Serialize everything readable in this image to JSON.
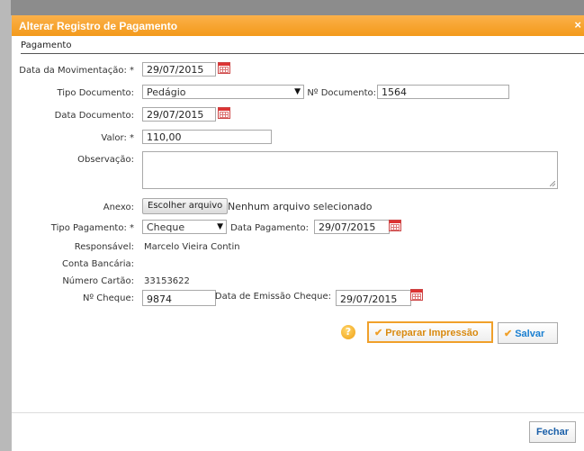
{
  "dialog": {
    "title": "Alterar Registro de Pagamento",
    "close_glyph": "×",
    "section": "Pagamento"
  },
  "form": {
    "data_movimentacao": {
      "label": "Data da Movimentação: *",
      "value": "29/07/2015"
    },
    "tipo_documento": {
      "label": "Tipo Documento:",
      "value": "Pedágio"
    },
    "numero_documento": {
      "label": "Nº Documento:",
      "value": "1564"
    },
    "data_documento": {
      "label": "Data Documento:",
      "value": "29/07/2015"
    },
    "valor": {
      "label": "Valor: *",
      "value": "110,00"
    },
    "observacao": {
      "label": "Observação:",
      "value": ""
    },
    "anexo": {
      "label": "Anexo:",
      "button": "Escolher arquivo",
      "status": "Nenhum arquivo selecionado"
    },
    "tipo_pagamento": {
      "label": "Tipo Pagamento: *",
      "value": "Cheque"
    },
    "data_pagamento": {
      "label": "Data Pagamento:",
      "value": "29/07/2015"
    },
    "responsavel": {
      "label": "Responsável:",
      "value": "Marcelo Vieira Contin"
    },
    "conta_bancaria": {
      "label": "Conta Bancária:",
      "value": ""
    },
    "numero_cartao": {
      "label": "Número Cartão:",
      "value": "33153622"
    },
    "numero_cheque": {
      "label": "Nº Cheque:",
      "value": "9874"
    },
    "data_emissao_cheque": {
      "label": "Data de Emissão Cheque:",
      "value": "29/07/2015"
    }
  },
  "actions": {
    "help_glyph": "?",
    "check_glyph": "✔",
    "dropdown_glyph": "▼",
    "preparar": "Preparar Impressão",
    "salvar": "Salvar",
    "fechar": "Fechar"
  },
  "colors": {
    "titlebar": "#f39a1b",
    "accent": "#f0a02a",
    "save_text": "#1a7fd0"
  },
  "icons": [
    "close-icon",
    "calendar-icon",
    "dropdown-arrow-icon",
    "help-icon",
    "check-icon",
    "resize-grip-icon"
  ]
}
